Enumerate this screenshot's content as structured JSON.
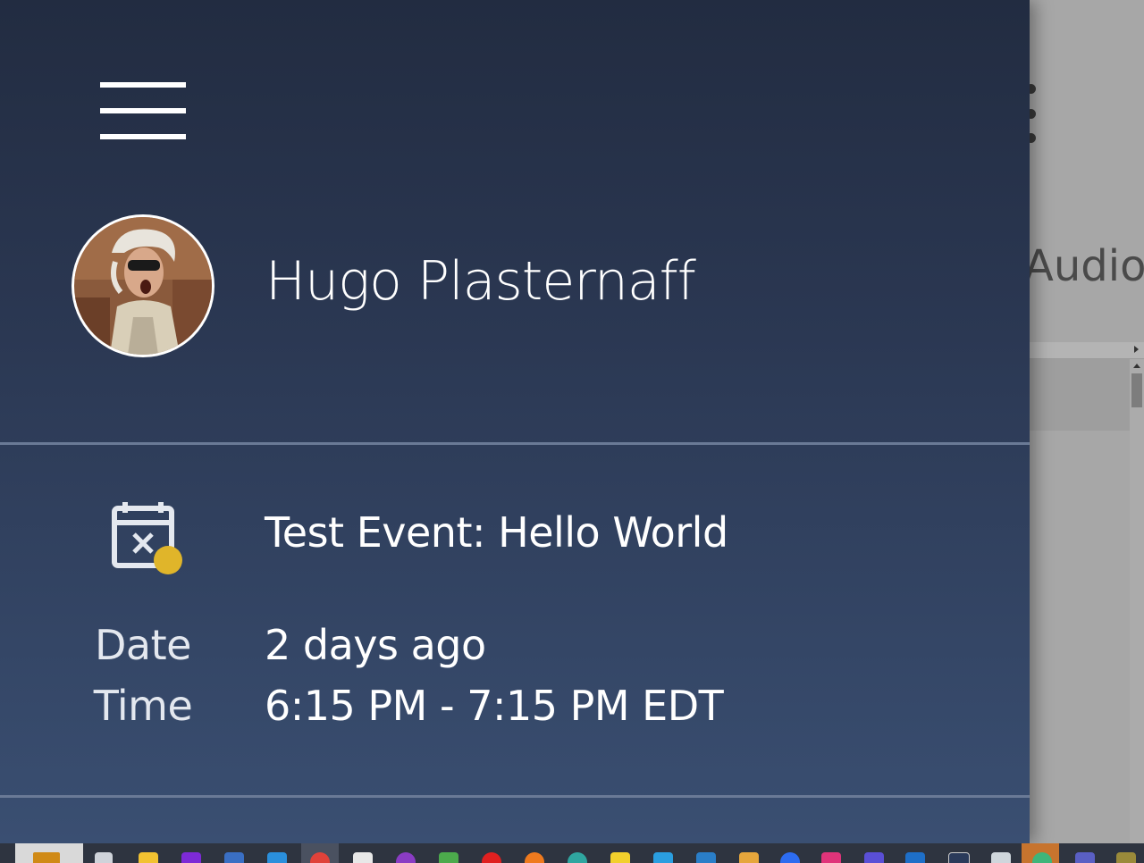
{
  "background_app": {
    "audio_label": "Audio"
  },
  "drawer": {
    "user_name": "Hugo Plasternaff",
    "event": {
      "title": "Test Event: Hello World",
      "date_label": "Date",
      "date_value": "2 days ago",
      "time_label": "Time",
      "time_value": "6:15 PM - 7:15 PM EDT",
      "status_dot_color": "#e0b52a"
    }
  },
  "taskbar": {
    "icons": [
      "task-view-icon",
      "file-explorer-icon",
      "visual-studio-icon",
      "powershell-icon",
      "vscode-icon",
      "chrome-icon",
      "notepad-icon",
      "github-desktop-icon",
      "android-icon",
      "youtube-music-icon",
      "firefox-icon",
      "edge-icon",
      "sticky-notes-icon",
      "store-icon",
      "teams-audio-icon",
      "paint-icon",
      "zoom-icon",
      "instagram-icon",
      "mastodon-icon",
      "outlook-icon",
      "terminal-icon",
      "pen-icon",
      "slack-icon",
      "teams-icon",
      "generic-app-icon"
    ]
  }
}
